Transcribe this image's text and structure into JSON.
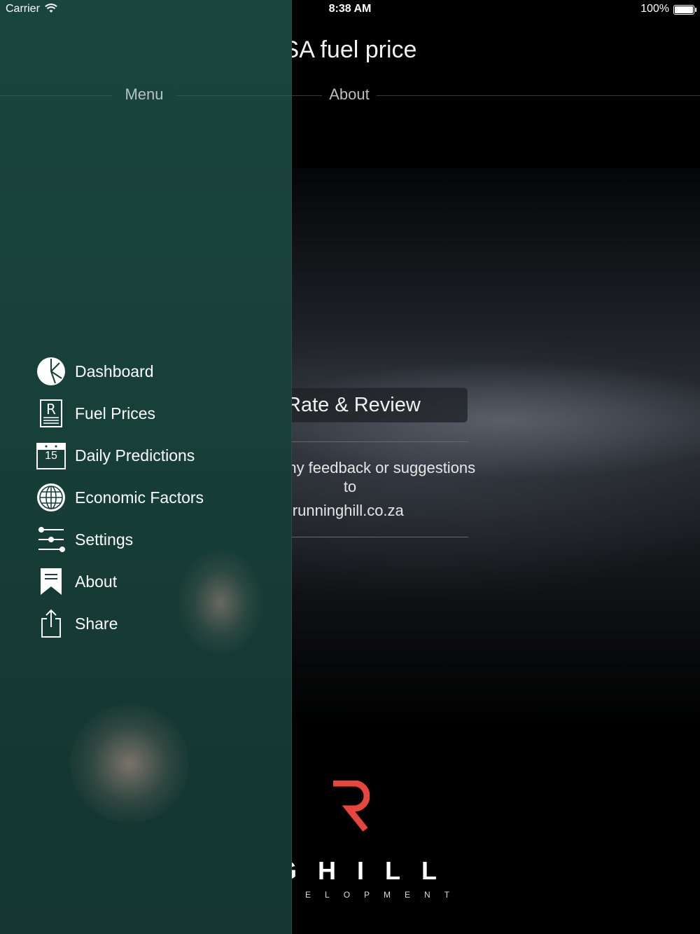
{
  "status_bar": {
    "carrier": "Carrier",
    "time": "8:38 AM",
    "battery": "100%"
  },
  "main": {
    "title": "SA fuel price",
    "section": "About",
    "rate_button": "Rate & Review",
    "feedback_text": "provide any feedback or suggestions to",
    "email": "o@runninghill.co.za",
    "logo_word": "INGHILL",
    "logo_sub": "E DEVELOPMENT"
  },
  "drawer": {
    "title": "Menu",
    "items": [
      {
        "label": "Dashboard",
        "icon": "pie-chart-icon"
      },
      {
        "label": "Fuel Prices",
        "icon": "receipt-r-icon"
      },
      {
        "label": "Daily Predictions",
        "icon": "calendar-icon",
        "calendar_day": "15"
      },
      {
        "label": "Economic Factors",
        "icon": "globe-icon"
      },
      {
        "label": "Settings",
        "icon": "sliders-icon"
      },
      {
        "label": "About",
        "icon": "bookmark-icon"
      },
      {
        "label": "Share",
        "icon": "share-icon"
      }
    ]
  },
  "colors": {
    "drawer_bg": "#174039",
    "logo_red": "#e8453c",
    "text": "#ffffff"
  }
}
